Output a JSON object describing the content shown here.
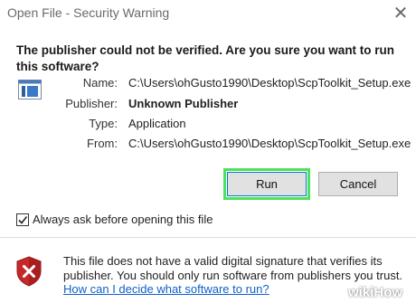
{
  "window": {
    "title": "Open File - Security Warning",
    "close_glyph": "✕"
  },
  "heading": "The publisher could not be verified.  Are you sure you want to run this software?",
  "details": [
    {
      "label": "Name:",
      "value": "C:\\Users\\ohGusto1990\\Desktop\\ScpToolkit_Setup.exe"
    },
    {
      "label": "Publisher:",
      "value": "Unknown Publisher"
    },
    {
      "label": "Type:",
      "value": "Application"
    },
    {
      "label": "From:",
      "value": "C:\\Users\\ohGusto1990\\Desktop\\ScpToolkit_Setup.exe"
    }
  ],
  "buttons": {
    "run": "Run",
    "cancel": "Cancel"
  },
  "checkbox": {
    "label": "Always ask before opening this file",
    "checked": true
  },
  "warning": {
    "text": "This file does not have a valid digital signature that verifies its publisher.  You should only run software from publishers you trust.",
    "link": "How can I decide what software to run?"
  },
  "watermark": {
    "prefix": "wiki",
    "suffix": "How"
  },
  "colors": {
    "highlight": "#4de25a",
    "link": "#1060c8",
    "shield": "#c62828"
  }
}
